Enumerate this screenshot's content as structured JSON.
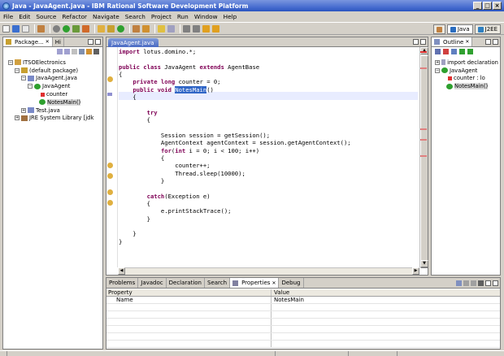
{
  "window": {
    "title": "Java - JavaAgent.java - IBM Rational Software Development Platform",
    "controls": [
      "_",
      "□",
      "×"
    ]
  },
  "menu": [
    "File",
    "Edit",
    "Source",
    "Refactor",
    "Navigate",
    "Search",
    "Project",
    "Run",
    "Window",
    "Help"
  ],
  "perspectives": [
    {
      "label": "Java",
      "active": true
    },
    {
      "label": "J2EE",
      "active": false
    }
  ],
  "package_explorer": {
    "tab_label": "Package...",
    "second_tab_label": "Hi",
    "tree": [
      {
        "label": "ITSOElectronics",
        "icon": "project-icon",
        "twisty": "−"
      },
      {
        "label": "(default package)",
        "icon": "package-icon",
        "twisty": "−"
      },
      {
        "label": "JavaAgent.java",
        "icon": "java-file-icon",
        "twisty": "−"
      },
      {
        "label": "JavaAgent",
        "icon": "class-icon",
        "twisty": "−"
      },
      {
        "label": "counter",
        "icon": "field-icon",
        "twisty": ""
      },
      {
        "label": "NotesMain()",
        "icon": "method-icon",
        "twisty": "",
        "selected": true
      },
      {
        "label": "Test.java",
        "icon": "java-file-icon",
        "twisty": "+"
      },
      {
        "label": "JRE System Library [jdk",
        "icon": "library-icon",
        "twisty": "+"
      }
    ]
  },
  "editor": {
    "tab_label": "JavaAgent.java",
    "code_lines": [
      {
        "parts": [
          {
            "t": "import",
            "k": 1
          },
          {
            "t": " lotus.domino.*;"
          }
        ]
      },
      {
        "parts": []
      },
      {
        "parts": [
          {
            "t": "public class",
            "k": 1
          },
          {
            "t": " JavaAgent "
          },
          {
            "t": "extends",
            "k": 1
          },
          {
            "t": " AgentBase"
          }
        ]
      },
      {
        "parts": [
          {
            "t": "{"
          }
        ]
      },
      {
        "parts": [
          {
            "t": "    "
          },
          {
            "t": "private long",
            "k": 1
          },
          {
            "t": " counter = 0;"
          }
        ]
      },
      {
        "parts": [
          {
            "t": "    "
          },
          {
            "t": "public void",
            "k": 1
          },
          {
            "t": " "
          },
          {
            "t": "NotesMain",
            "sel": 1
          },
          {
            "t": "()"
          }
        ]
      },
      {
        "parts": [
          {
            "t": "    {"
          }
        ]
      },
      {
        "parts": []
      },
      {
        "parts": [
          {
            "t": "        "
          },
          {
            "t": "try",
            "k": 1
          }
        ]
      },
      {
        "parts": [
          {
            "t": "        {"
          }
        ]
      },
      {
        "parts": []
      },
      {
        "parts": [
          {
            "t": "            Session session = getSession();"
          }
        ]
      },
      {
        "parts": [
          {
            "t": "            AgentContext agentContext = session.getAgentContext();"
          }
        ]
      },
      {
        "parts": [
          {
            "t": "            "
          },
          {
            "t": "for",
            "k": 1
          },
          {
            "t": "("
          },
          {
            "t": "int",
            "k": 1
          },
          {
            "t": " i = 0; i < 100; i++)"
          }
        ]
      },
      {
        "parts": [
          {
            "t": "            {"
          }
        ]
      },
      {
        "parts": [
          {
            "t": "                counter++;"
          }
        ]
      },
      {
        "parts": [
          {
            "t": "                Thread.sleep(10000);"
          }
        ]
      },
      {
        "parts": [
          {
            "t": "            }"
          }
        ]
      },
      {
        "parts": []
      },
      {
        "parts": [
          {
            "t": "        "
          },
          {
            "t": "catch",
            "k": 1
          },
          {
            "t": "(Exception e)"
          }
        ]
      },
      {
        "parts": [
          {
            "t": "        {"
          }
        ]
      },
      {
        "parts": [
          {
            "t": "            e.printStackTrace();"
          }
        ]
      },
      {
        "parts": [
          {
            "t": "        }"
          }
        ]
      },
      {
        "parts": []
      },
      {
        "parts": [
          {
            "t": "    }"
          }
        ]
      },
      {
        "parts": [
          {
            "t": "}"
          }
        ]
      }
    ]
  },
  "outline": {
    "tab_label": "Outline",
    "tree": [
      {
        "label": "import declaration",
        "icon": "imports-icon",
        "twisty": "+"
      },
      {
        "label": "JavaAgent",
        "icon": "class-icon",
        "twisty": "−"
      },
      {
        "label": "counter : lo",
        "icon": "field-icon",
        "twisty": ""
      },
      {
        "label": "NotesMain()",
        "icon": "method-icon",
        "twisty": "",
        "selected": true
      }
    ]
  },
  "bottom_views": {
    "tabs": [
      {
        "label": "Problems",
        "active": false
      },
      {
        "label": "Javadoc",
        "active": false
      },
      {
        "label": "Declaration",
        "active": false
      },
      {
        "label": "Search",
        "active": false
      },
      {
        "label": "Properties",
        "active": true
      },
      {
        "label": "Debug",
        "active": false
      }
    ],
    "properties": {
      "header": {
        "property": "Property",
        "value": "Value"
      },
      "rows": [
        {
          "property": "Name",
          "value": "NotesMain"
        }
      ]
    }
  }
}
